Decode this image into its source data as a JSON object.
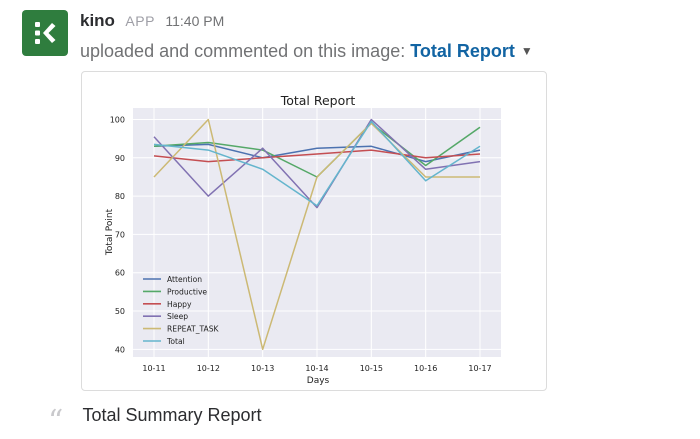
{
  "message": {
    "author": "kino",
    "app_tag": "APP",
    "time": "11:40 PM",
    "uploaded_text": "uploaded and commented on this image: ",
    "file_name": "Total Report",
    "comment": "Total Summary Report"
  },
  "icons": {
    "avatar": "kino-logo-icon",
    "caret": "chevron-down-icon",
    "quote": "quote-icon"
  },
  "colors": {
    "avatar_bg": "#2f7d3e",
    "link": "#1264a3",
    "plot_bg": "#eaeaf2"
  },
  "chart_data": {
    "type": "line",
    "title": "Total Report",
    "xlabel": "Days",
    "ylabel": "Total Point",
    "categories": [
      "10-11",
      "10-12",
      "10-13",
      "10-14",
      "10-15",
      "10-16",
      "10-17"
    ],
    "ylim": [
      38,
      103
    ],
    "yticks": [
      40,
      50,
      60,
      70,
      80,
      90,
      100
    ],
    "grid": true,
    "legend_position": "bottom-left",
    "series": [
      {
        "name": "Attention",
        "color": "#4c72b0",
        "values": [
          93,
          93.5,
          90,
          92.5,
          93,
          89,
          92
        ]
      },
      {
        "name": "Productive",
        "color": "#55a868",
        "values": [
          93,
          94,
          92,
          85,
          99,
          88,
          98
        ]
      },
      {
        "name": "Happy",
        "color": "#c44e52",
        "values": [
          90.5,
          89,
          90,
          91,
          92,
          90,
          91
        ]
      },
      {
        "name": "Sleep",
        "color": "#8172b2",
        "values": [
          95.5,
          80,
          92.5,
          77,
          100,
          87,
          89
        ]
      },
      {
        "name": "REPEAT_TASK",
        "color": "#ccb974",
        "values": [
          85,
          100,
          40,
          85,
          99,
          85,
          85
        ]
      },
      {
        "name": "Total",
        "color": "#64b5cd",
        "values": [
          93.5,
          92,
          87,
          77.5,
          99.5,
          84,
          93
        ]
      }
    ]
  }
}
